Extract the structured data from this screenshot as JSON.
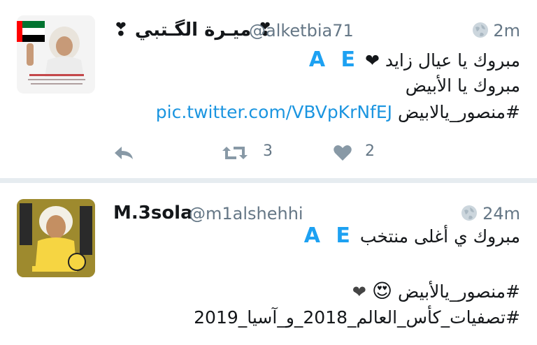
{
  "tweets": [
    {
      "name": "❣ ميـرة الگـتبي ❣",
      "handle": "@alketbia71",
      "time": "2m",
      "lines": [
        "مبروك يا عيال زايد ❤",
        "مبروك يا الأبيض",
        "#منصور_يالابيض"
      ],
      "badge": "A E",
      "link": "pic.twitter.com/VBVpKrNfEJ",
      "retweets": "3",
      "likes": "2",
      "icons": [
        "globe-icon",
        "reply-icon",
        "retweet-icon",
        "like-icon"
      ]
    },
    {
      "name": "M.3sola",
      "handle": "@m1alshehhi",
      "time": "24m",
      "lines": [
        "مبروك ي أغلى منتخب",
        "#منصور_يالأبيض",
        "#تصفيات_كأس_العالم_2018_و_آسيا_2019"
      ],
      "badge": "A E",
      "emoji": "😍",
      "heart": "❤"
    }
  ],
  "colors": {
    "link": "#1b95e0",
    "badge": "#1da1f2",
    "muted": "#657786",
    "divider": "#e6ecf0"
  }
}
